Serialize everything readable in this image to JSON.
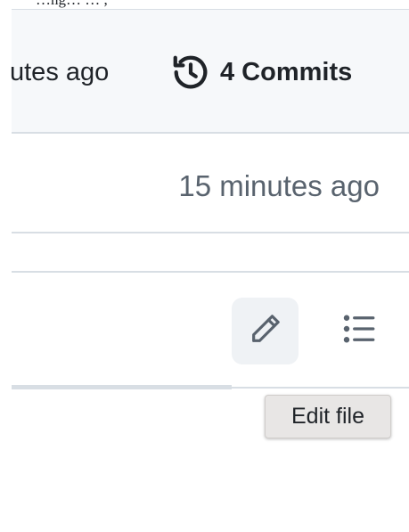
{
  "top_fragment": "…ng…   …  ,  ",
  "commit_bar": {
    "time_text": "utes ago",
    "commits_label": "4 Commits"
  },
  "file_row": {
    "time_text": "15 minutes ago"
  },
  "toolbar": {
    "edit_tooltip": "Edit file"
  },
  "icons": {
    "history": "history-icon",
    "edit": "pencil-icon",
    "outline": "list-icon"
  }
}
